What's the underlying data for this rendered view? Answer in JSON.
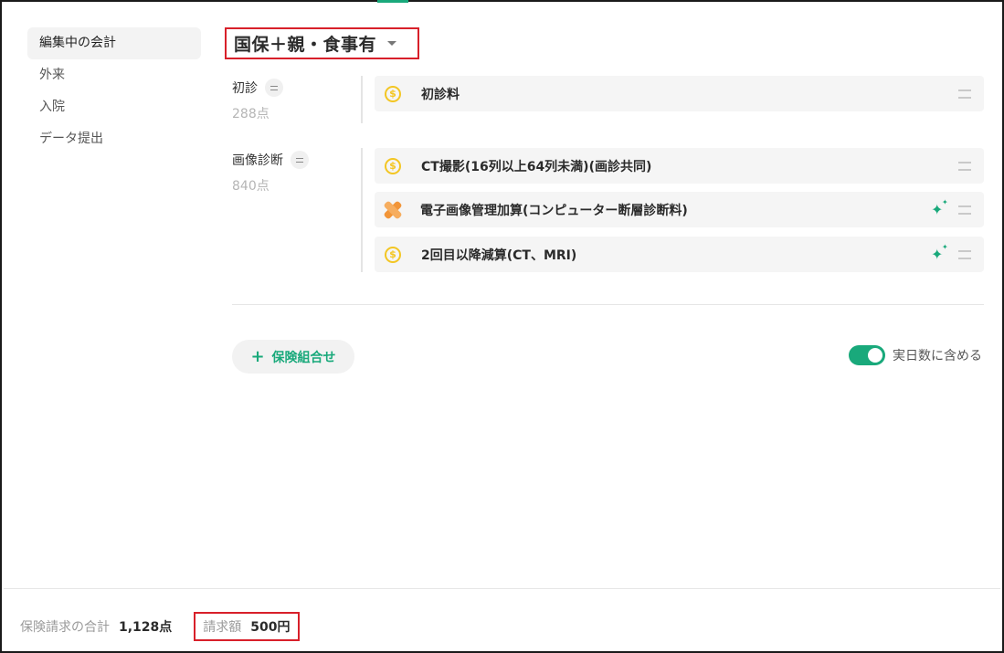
{
  "sidebar": {
    "items": [
      {
        "label": "編集中の会計",
        "active": true
      },
      {
        "label": "外来",
        "active": false
      },
      {
        "label": "入院",
        "active": false
      },
      {
        "label": "データ提出",
        "active": false
      }
    ]
  },
  "header": {
    "title": "国保＋親・食事有"
  },
  "groups": [
    {
      "label": "初診",
      "points": "288点",
      "items": [
        {
          "icon": "coin-icon",
          "label": "初診料",
          "sparkle": false
        }
      ]
    },
    {
      "label": "画像診断",
      "points": "840点",
      "items": [
        {
          "icon": "coin-icon",
          "label": "CT撮影(16列以上64列未満)(画診共同)",
          "sparkle": false
        },
        {
          "icon": "bandage-icon",
          "label": "電子画像管理加算(コンピューター断層診断料)",
          "sparkle": true
        },
        {
          "icon": "coin-icon",
          "label": "2回目以降減算(CT、MRI)",
          "sparkle": true
        }
      ]
    }
  ],
  "actions": {
    "add_insurance_label": "保険組合せ",
    "toggle_label": "実日数に含める",
    "toggle_on": true
  },
  "footer": {
    "total_label": "保険請求の合計",
    "total_value": "1,128点",
    "claim_label": "請求額",
    "claim_value": "500円"
  },
  "colors": {
    "accent": "#19a97b",
    "highlight_border": "#d8202a",
    "coin": "#f3c623",
    "bandage": "#f29538"
  }
}
